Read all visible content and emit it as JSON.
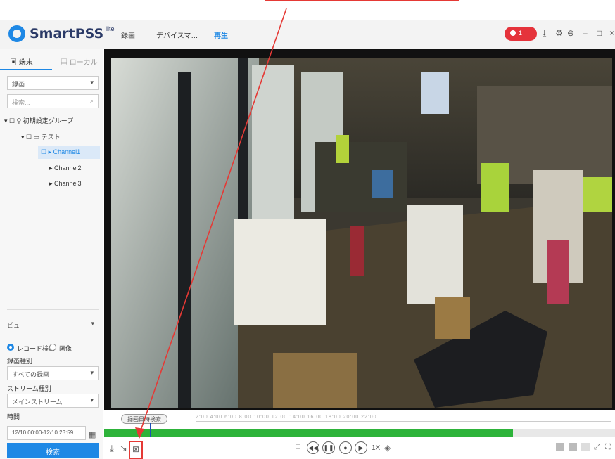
{
  "app": {
    "name": "SmartPSS",
    "edition": "lite"
  },
  "nav": [
    "録画",
    "デバイスマ…",
    "再生"
  ],
  "alarm_badge": "1",
  "left_panel": {
    "tabs": [
      "端末",
      "ローカル"
    ],
    "type_select": "録画",
    "search_placeholder": "検索...",
    "tree": {
      "group": "初期設定グループ",
      "device": "テスト",
      "channels": [
        "Channel1",
        "Channel2",
        "Channel3"
      ],
      "selected_channel": "Channel1"
    },
    "view_label": "ビュー",
    "radio_options": [
      "レコード検索",
      "画像"
    ],
    "record_type_label": "録画種別",
    "record_type_value": "すべての録画",
    "stream_label": "ストリーム種別",
    "stream_value": "メインストリーム",
    "time_label": "時間",
    "time_value": "12/10 00:00-12/10 23:59",
    "search_button": "検索"
  },
  "timeline": {
    "range_label": "録画日時検索",
    "ticks": "2:00  4:00  6:00  8:00  10:00  12:00  14:00  16:00  18:00  20:00  22:00",
    "recorded_fraction": 0.8,
    "cursor_fraction": 0.09
  },
  "controls": {
    "speed": "1X"
  },
  "colors": {
    "accent": "#1e88e5",
    "record_green": "#2db33a",
    "annotation_red": "#e53935"
  },
  "icons": [
    "download-icon",
    "snapshot-icon",
    "clip-icon",
    "stop-icon",
    "rewind-icon",
    "pause-icon",
    "record-icon",
    "forward-icon",
    "volume-icon"
  ]
}
